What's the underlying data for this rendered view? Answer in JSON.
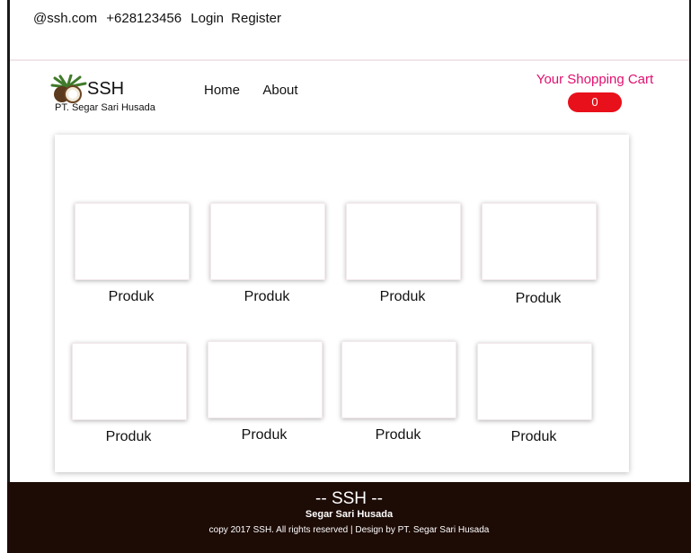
{
  "topbar": {
    "email": "@ssh.com",
    "phone": "+628123456",
    "login": "Login",
    "register": "Register"
  },
  "header": {
    "brand": "SSH",
    "company": "PT. Segar Sari Husada",
    "nav": [
      "Home",
      "About"
    ],
    "cart_title": "Your Shopping Cart",
    "cart_count": "0"
  },
  "products": [
    {
      "name": "Produk"
    },
    {
      "name": "Produk"
    },
    {
      "name": "Produk"
    },
    {
      "name": "Produk"
    },
    {
      "name": "Produk"
    },
    {
      "name": "Produk"
    },
    {
      "name": "Produk"
    },
    {
      "name": "Produk"
    }
  ],
  "footer": {
    "title": "-- SSH --",
    "subtitle": "Segar Sari Husada",
    "copyright": "copy 2017 SSH. All rights reserved | Design by PT. Segar Sari Husada"
  },
  "colors": {
    "cart_title": "#e0106f",
    "cart_badge": "#e8101a",
    "footer_bg": "#1d0b05"
  }
}
